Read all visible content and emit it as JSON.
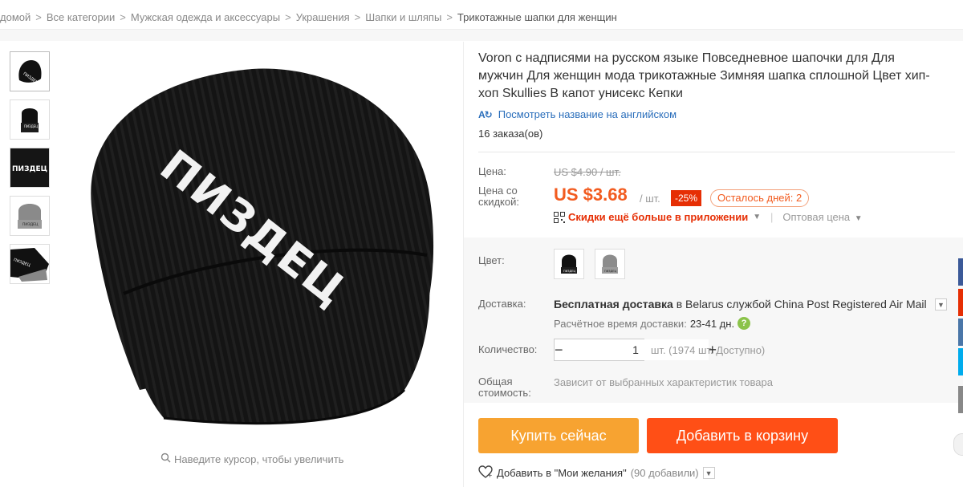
{
  "breadcrumb": {
    "items": [
      "домой",
      "Все категории",
      "Мужская одежда и аксессуары",
      "Украшения",
      "Шапки и шляпы",
      "Трикотажные шапки для женщин"
    ],
    "separator": ">"
  },
  "gallery": {
    "image_text": "ПИЗДЕЦ",
    "zoom_hint": "Наведите курсор, чтобы увеличить",
    "thumbnails": [
      "black-beanie",
      "black-beanie-front",
      "black-beanie-text",
      "gray-beanie",
      "black-beanie-folded"
    ]
  },
  "product": {
    "title": "Voron с надписями на русском языке Повседневное шапочки для Для мужчин Для женщин мода трикотажные Зимняя шапка сплошной Цвет хип-хоп Skullies В капот унисекс Кепки",
    "translate_link": "Посмотреть название на английском",
    "translate_icon": "А",
    "orders": "16 заказа(ов)"
  },
  "price": {
    "price_label": "Цена:",
    "old_price": "US $4.90 / шт.",
    "discount_label_1": "Цена со",
    "discount_label_2": "скидкой:",
    "new_price": "US $3.68",
    "per_unit": "/ шт.",
    "discount": "-25%",
    "days_left": "Осталось дней: 2",
    "app_discount": "Скидки ещё больше в приложении",
    "wholesale": "Оптовая цена"
  },
  "options": {
    "color_label": "Цвет:",
    "colors": [
      "черный",
      "серый"
    ],
    "shipping_label": "Доставка:",
    "shipping_free": "Бесплатная доставка",
    "shipping_to": "в",
    "shipping_country": "Belarus",
    "shipping_via": "службой",
    "shipping_service": "China Post Registered Air Mail",
    "eta_label": "Расчётное время доставки:",
    "eta_days": "23-41 дн.",
    "qty_label": "Количество:",
    "qty_value": "1",
    "qty_available": "шт. (1974 шт. Доступно)",
    "total_label_1": "Общая",
    "total_label_2": "стоимость:",
    "total_note": "Зависит от выбранных характеристик товара"
  },
  "actions": {
    "buy_now": "Купить сейчас",
    "add_to_cart": "Добавить в корзину",
    "wishlist": "Добавить в \"Мои желания\"",
    "wishlist_count": "(90 добавили)"
  },
  "colors": {
    "price": "#f25b1f",
    "discount_badge": "#e62e04",
    "buy_now": "#f7a331",
    "add_to_cart": "#ff4f16",
    "link": "#2a6ebb",
    "social": [
      "#3b5998",
      "#e62e04",
      "#4a76a8",
      "#00aced",
      "#888888"
    ]
  }
}
